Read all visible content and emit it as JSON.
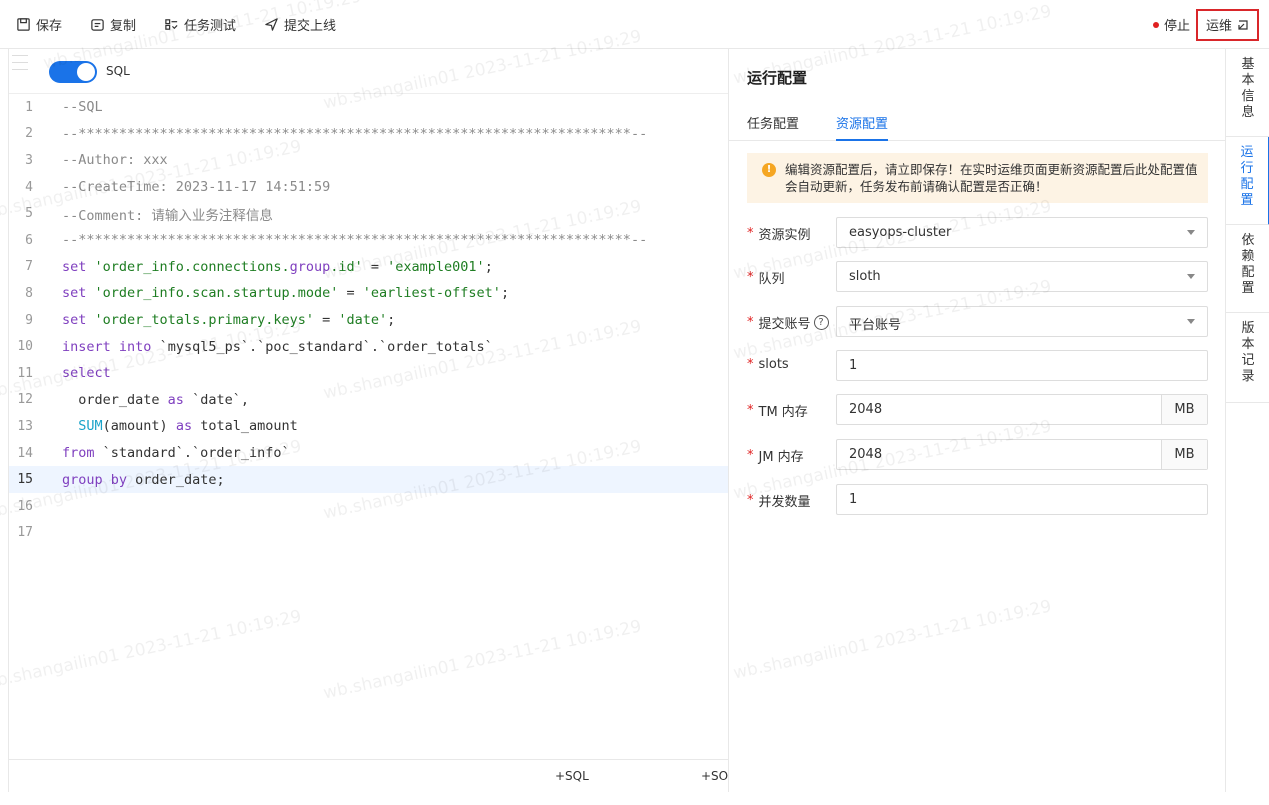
{
  "toolbar": {
    "save_label": "保存",
    "copy_label": "复制",
    "test_label": "任务测试",
    "submit_label": "提交上线",
    "stop_label": "停止",
    "ops_label": "运维"
  },
  "editor": {
    "mode_label": "SQL",
    "lines": [
      "--SQL",
      "--********************************************************************--",
      "--Author: xxx",
      "--CreateTime: 2023-11-17 14:51:59",
      "--Comment: 请输入业务注释信息",
      "--********************************************************************--",
      "set 'order_info.connections.group.id' = 'example001';",
      "set 'order_info.scan.startup.mode' = 'earliest-offset';",
      "set 'order_totals.primary.keys' = 'date';",
      "insert into `mysql5_ps`.`poc_standard`.`order_totals`",
      "select",
      "  order_date as `date`,",
      "  SUM(amount) as total_amount",
      "from `standard`.`order_info`",
      "group by order_date;",
      "",
      ""
    ],
    "line_numbers": [
      "1",
      "2",
      "3",
      "4",
      "5",
      "6",
      "7",
      "8",
      "9",
      "10",
      "11",
      "12",
      "13",
      "14",
      "15",
      "16",
      "17"
    ],
    "add_sql_label": "+SQL",
    "add_so_label": "+SO"
  },
  "panel": {
    "title": "运行配置",
    "tabs": [
      "任务配置",
      "资源配置"
    ],
    "alert": "编辑资源配置后，请立即保存！在实时运维页面更新资源配置后此处配置值会自动更新，任务发布前请确认配置是否正确！",
    "fields": [
      {
        "label": "资源实例",
        "value": "easyops-cluster"
      },
      {
        "label": "队列",
        "value": "sloth"
      },
      {
        "label": "提交账号",
        "value": "平台账号"
      },
      {
        "label": "slots",
        "value": "1"
      },
      {
        "label": "TM 内存",
        "value": "2048",
        "unit": "MB"
      },
      {
        "label": "JM 内存",
        "value": "2048",
        "unit": "MB"
      },
      {
        "label": "并发数量",
        "value": "1"
      }
    ]
  },
  "side_tabs": [
    {
      "label": "基本信息"
    },
    {
      "label": "运行配置"
    },
    {
      "label": "依赖配置"
    },
    {
      "label": "版本记录"
    }
  ],
  "watermark": "wb.shangailin01 2023-11-21 10:19:29",
  "colors": {
    "accent": "#1a73e8",
    "danger": "#e02020",
    "alert_bg": "#fdf3e4",
    "warn": "#f5a623"
  }
}
